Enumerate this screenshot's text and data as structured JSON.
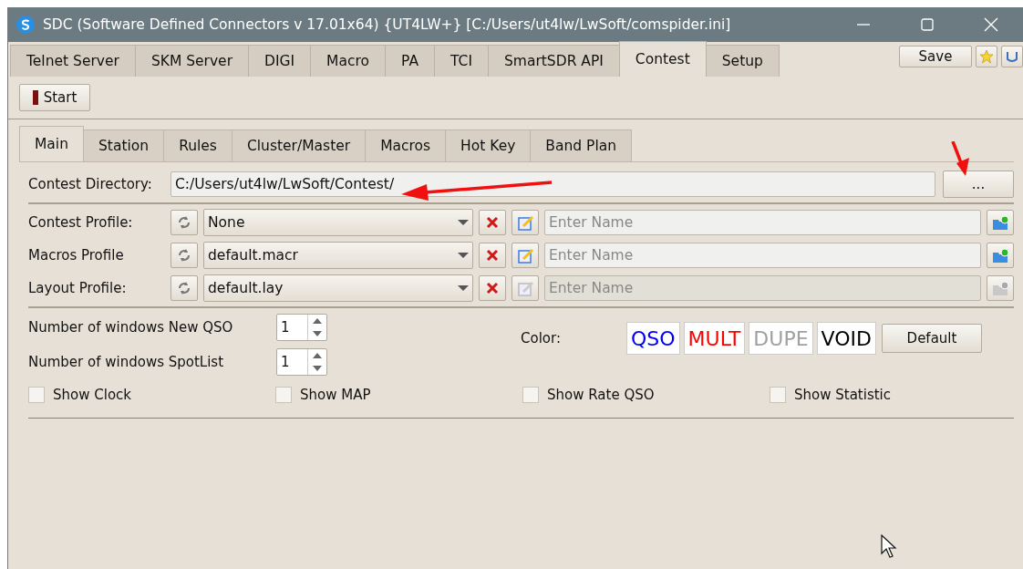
{
  "window": {
    "title": "SDC (Software Defined Connectors v 17.01x64) {UT4LW+} [C:/Users/ut4lw/LwSoft/comspider.ini]"
  },
  "tabs": [
    {
      "label": "Telnet Server",
      "selected": false
    },
    {
      "label": "SKM Server",
      "selected": false
    },
    {
      "label": "DIGI",
      "selected": false
    },
    {
      "label": "Macro",
      "selected": false
    },
    {
      "label": "PA",
      "selected": false
    },
    {
      "label": "TCI",
      "selected": false
    },
    {
      "label": "SmartSDR API",
      "selected": false
    },
    {
      "label": "Contest",
      "selected": true
    },
    {
      "label": "Setup",
      "selected": false
    }
  ],
  "save_button": "Save",
  "start_button": "Start",
  "subtabs": [
    {
      "label": "Main",
      "selected": true
    },
    {
      "label": "Station",
      "selected": false
    },
    {
      "label": "Rules",
      "selected": false
    },
    {
      "label": "Cluster/Master",
      "selected": false
    },
    {
      "label": "Macros",
      "selected": false
    },
    {
      "label": "Hot Key",
      "selected": false
    },
    {
      "label": "Band Plan",
      "selected": false
    }
  ],
  "directory": {
    "label": "Contest Directory:",
    "value": "C:/Users/ut4lw/LwSoft/Contest/",
    "browse": "..."
  },
  "profiles": [
    {
      "label": "Contest Profile:",
      "value": "None",
      "placeholder": "Enter Name",
      "disabled": false
    },
    {
      "label": "Macros Profile",
      "value": "default.macr",
      "placeholder": "Enter Name",
      "disabled": false
    },
    {
      "label": "Layout Profile:",
      "value": "default.lay",
      "placeholder": "Enter Name",
      "disabled": true
    }
  ],
  "spinners": [
    {
      "label": "Number of windows New QSO",
      "value": "1"
    },
    {
      "label": "Number of windows SpotList",
      "value": "1"
    }
  ],
  "color": {
    "label": "Color:",
    "swatches": [
      {
        "label": "QSO",
        "color": "#0000ff"
      },
      {
        "label": "MULT",
        "color": "#ff0000"
      },
      {
        "label": "DUPE",
        "color": "#a0a0a0"
      },
      {
        "label": "VOID",
        "color": "#000000"
      }
    ],
    "default_button": "Default"
  },
  "checkboxes": [
    {
      "label": "Show Clock",
      "checked": false
    },
    {
      "label": "Show MAP",
      "checked": false
    },
    {
      "label": "Show Rate QSO",
      "checked": false
    },
    {
      "label": "Show Statistic",
      "checked": false
    }
  ]
}
